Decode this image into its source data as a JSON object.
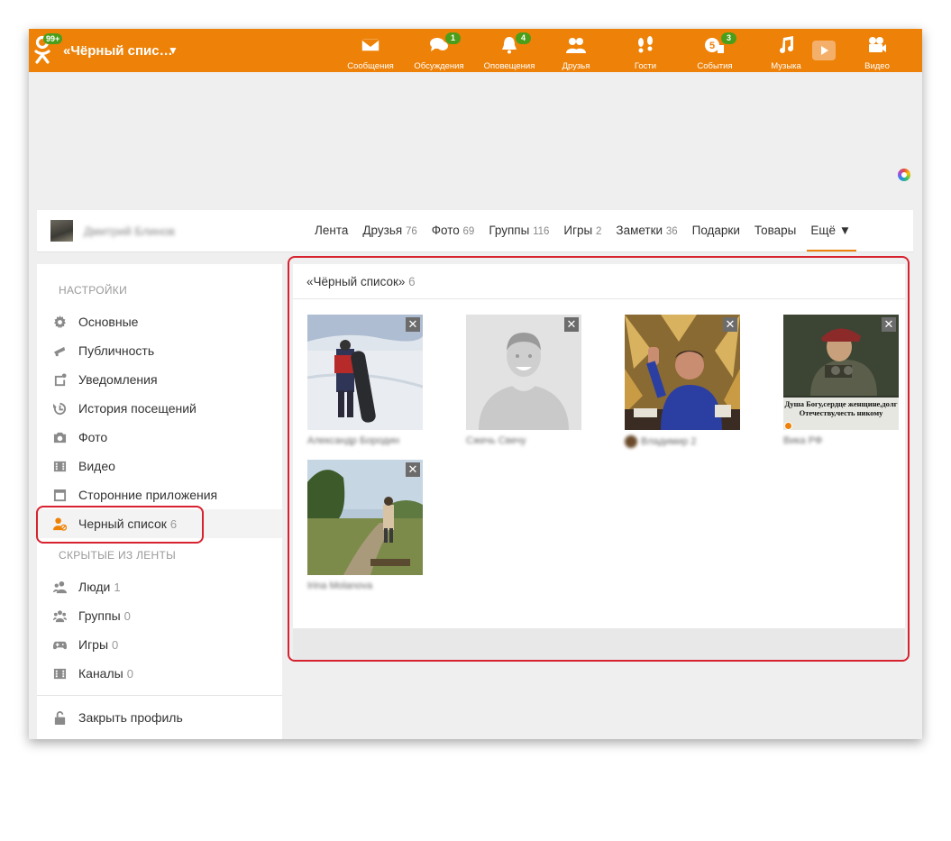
{
  "topbar": {
    "title": "«Чёрный спис…",
    "logo_badge": "99+",
    "nav": [
      {
        "label": "Сообщения",
        "icon": "envelope-icon",
        "badge": ""
      },
      {
        "label": "Обсуждения",
        "icon": "chat-bubbles-icon",
        "badge": "1"
      },
      {
        "label": "Оповещения",
        "icon": "bell-icon",
        "badge": "4"
      },
      {
        "label": "Друзья",
        "icon": "friends-icon",
        "badge": ""
      },
      {
        "label": "Гости",
        "icon": "footprints-icon",
        "badge": ""
      },
      {
        "label": "События",
        "icon": "events-icon",
        "badge": "3"
      },
      {
        "label": "Музыка",
        "icon": "music-note-icon",
        "badge": ""
      },
      {
        "label": "Видео",
        "icon": "video-camera-icon",
        "badge": ""
      }
    ]
  },
  "profile": {
    "name": "Дмитрий Блинов",
    "tabs": [
      {
        "label": "Лента",
        "count": ""
      },
      {
        "label": "Друзья",
        "count": "76"
      },
      {
        "label": "Фото",
        "count": "69"
      },
      {
        "label": "Группы",
        "count": "116"
      },
      {
        "label": "Игры",
        "count": "2"
      },
      {
        "label": "Заметки",
        "count": "36"
      },
      {
        "label": "Подарки",
        "count": ""
      },
      {
        "label": "Товары",
        "count": ""
      },
      {
        "label": "Ещё ▼",
        "count": ""
      }
    ]
  },
  "sidebar": {
    "settings_heading": "НАСТРОЙКИ",
    "settings": [
      {
        "label": "Основные",
        "count": "",
        "icon": "gear-icon"
      },
      {
        "label": "Публичность",
        "count": "",
        "icon": "megaphone-icon"
      },
      {
        "label": "Уведомления",
        "count": "",
        "icon": "notification-icon"
      },
      {
        "label": "История посещений",
        "count": "",
        "icon": "history-icon"
      },
      {
        "label": "Фото",
        "count": "",
        "icon": "camera-icon"
      },
      {
        "label": "Видео",
        "count": "",
        "icon": "film-icon"
      },
      {
        "label": "Сторонние приложения",
        "count": "",
        "icon": "apps-icon"
      },
      {
        "label": "Черный список",
        "count": "6",
        "icon": "blocked-user-icon"
      }
    ],
    "hidden_heading": "СКРЫТЫЕ ИЗ ЛЕНТЫ",
    "hidden": [
      {
        "label": "Люди",
        "count": "1",
        "icon": "people-icon"
      },
      {
        "label": "Группы",
        "count": "0",
        "icon": "groups-icon"
      },
      {
        "label": "Игры",
        "count": "0",
        "icon": "gamepad-icon"
      },
      {
        "label": "Каналы",
        "count": "0",
        "icon": "channels-icon"
      }
    ],
    "close_profile": "Закрыть профиль"
  },
  "blacklist": {
    "title": "«Чёрный список»",
    "count": "6",
    "remove_glyph": "✕",
    "users": [
      {
        "name": "Александр Бородин",
        "photo_caption": ""
      },
      {
        "name": "Сжечь Свечу",
        "photo_caption": ""
      },
      {
        "name": "Владимир 2",
        "photo_caption": ""
      },
      {
        "name": "Вика РФ",
        "photo_caption": "Душа Богу,сердце женщине,долг Отечеству,честь никому"
      },
      {
        "name": "Irina Molanova",
        "photo_caption": ""
      }
    ]
  }
}
